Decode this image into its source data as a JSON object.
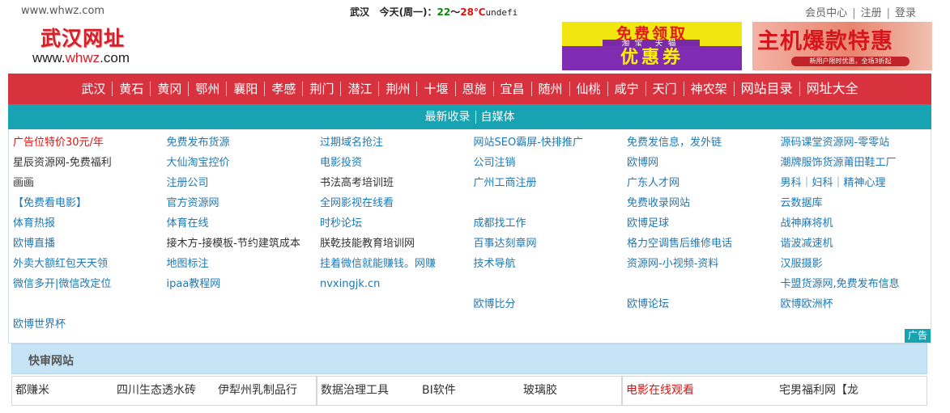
{
  "topbar": {
    "site_url": "www.whwz.com",
    "weather_city": "武汉",
    "weather_day": "今天(周一)：",
    "temp_low": "22",
    "temp_sep": "～",
    "temp_high": "28℃",
    "weather_tail": "undefi",
    "links": [
      "会员中心",
      "注册",
      "登录"
    ]
  },
  "logo": {
    "cn": "武汉网址",
    "en_prefix": "www.",
    "en_mid": "whwz",
    "en_suffix": ".com"
  },
  "ads": {
    "ad1_line1": "免费领取",
    "ad1_line2": "淘宝 天猫",
    "ad1_line3": "优惠券",
    "ad2_line1": "主机爆款特惠",
    "ad2_line2": "新用户限时优惠，全场3折起"
  },
  "cities": [
    "武汉",
    "黄石",
    "黄冈",
    "鄂州",
    "襄阳",
    "孝感",
    "荆门",
    "潜江",
    "荆州",
    "十堰",
    "恩施",
    "宜昌",
    "随州",
    "仙桃",
    "咸宁",
    "天门",
    "神农架",
    "网站目录",
    "网址大全"
  ],
  "subnav": [
    "最新收录",
    "自媒体"
  ],
  "links": [
    [
      {
        "t": "广告位特价30元/年",
        "c": "red"
      },
      {
        "t": "免费发布货源"
      },
      {
        "t": "过期域名抢注"
      },
      {
        "t": "网站SEO霸屏-快排推广"
      },
      {
        "t": "免费发信息，发外链"
      },
      {
        "t": "源码课堂资源网-零零站"
      }
    ],
    [
      {
        "t": "星辰资源网-免费福利",
        "c": "dark"
      },
      {
        "t": "大仙淘宝控价"
      },
      {
        "t": "电影投资"
      },
      {
        "t": "公司注销"
      },
      {
        "t": "欧博网"
      },
      {
        "t": "潮牌服饰货源莆田鞋工厂"
      }
    ],
    [
      {
        "t": "画画",
        "c": "dark"
      },
      {
        "t": "注册公司"
      },
      {
        "t": "书法高考培训班",
        "c": "dark"
      },
      {
        "t": "广州工商注册"
      },
      {
        "t": "广东人才网"
      },
      {
        "t": "男科｜妇科｜精神心理"
      }
    ],
    [
      {
        "t": "【免费看电影】"
      },
      {
        "t": "官方资源网"
      },
      {
        "t": "全网影视在线看"
      },
      {
        "t": ""
      },
      {
        "t": "免费收录网站"
      },
      {
        "t": "云数据库"
      }
    ],
    [
      {
        "t": "体育热报"
      },
      {
        "t": "体育在线"
      },
      {
        "t": "时秒论坛"
      },
      {
        "t": "成都找工作"
      },
      {
        "t": "欧博足球"
      },
      {
        "t": "战神麻将机"
      }
    ],
    [
      {
        "t": "欧博直播"
      },
      {
        "t": "接木方-接模板-节约建筑成本",
        "c": "dark"
      },
      {
        "t": "朕乾技能教育培训网",
        "c": "dark"
      },
      {
        "t": "百事达刻章网"
      },
      {
        "t": "格力空调售后维修电话"
      },
      {
        "t": "谐波减速机"
      }
    ],
    [
      {
        "t": "外卖大额红包天天领"
      },
      {
        "t": "地图标注"
      },
      {
        "t": "挂着微信就能赚钱。网赚"
      },
      {
        "t": "技术导航"
      },
      {
        "t": "资源网-小视频-资料"
      },
      {
        "t": "汉服摄影"
      }
    ],
    [
      {
        "t": "微信多开|微信改定位"
      },
      {
        "t": "ipaa教程网"
      },
      {
        "t": "nvxingjk.cn"
      },
      {
        "t": ""
      },
      {
        "t": ""
      },
      {
        "t": "卡盟货源网,免费发布信息"
      }
    ],
    [
      {
        "t": ""
      },
      {
        "t": ""
      },
      {
        "t": ""
      },
      {
        "t": "欧博比分"
      },
      {
        "t": "欧博论坛"
      },
      {
        "t": "欧博欧洲杯"
      }
    ],
    [
      {
        "t": "欧博世界杯"
      },
      {
        "t": ""
      },
      {
        "t": ""
      },
      {
        "t": ""
      },
      {
        "t": ""
      },
      {
        "t": ""
      }
    ]
  ],
  "ad_tag": "广告",
  "quick": {
    "title": "快审网站",
    "groups": [
      [
        {
          "t": "都赚米"
        },
        {
          "t": "四川生态透水砖"
        },
        {
          "t": "伊犁州乳制品行"
        }
      ],
      [
        {
          "t": "数据治理工具"
        },
        {
          "t": "BI软件"
        },
        {
          "t": "玻璃胶"
        }
      ],
      [
        {
          "t": "电影在线观看",
          "c": "red"
        },
        {
          "t": "宅男福利网【龙"
        }
      ]
    ]
  }
}
